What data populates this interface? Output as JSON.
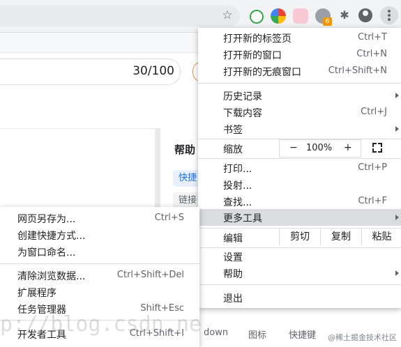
{
  "toolbar": {
    "star_icon": "bookmark-star-icon",
    "extension_badge": "6"
  },
  "page": {
    "counter": "30/100",
    "help_title": "帮助",
    "chip1": "快捷",
    "chip2": "链接"
  },
  "menu": {
    "new_tab": {
      "label": "打开新的标签页",
      "shortcut": "Ctrl+T"
    },
    "new_window": {
      "label": "打开新的窗口",
      "shortcut": "Ctrl+N"
    },
    "new_incognito": {
      "label": "打开新的无痕窗口",
      "shortcut": "Ctrl+Shift+N"
    },
    "history": {
      "label": "历史记录"
    },
    "downloads": {
      "label": "下载内容",
      "shortcut": "Ctrl+J"
    },
    "bookmarks": {
      "label": "书签"
    },
    "zoom": {
      "label": "缩放",
      "minus": "−",
      "value": "100%",
      "plus": "+"
    },
    "print": {
      "label": "打印...",
      "shortcut": "Ctrl+P"
    },
    "cast": {
      "label": "投射..."
    },
    "find": {
      "label": "查找...",
      "shortcut": "Ctrl+F"
    },
    "more_tools": {
      "label": "更多工具"
    },
    "edit": {
      "label": "编辑",
      "cut": "剪切",
      "copy": "复制",
      "paste": "粘贴"
    },
    "settings": {
      "label": "设置"
    },
    "help": {
      "label": "帮助"
    },
    "exit": {
      "label": "退出"
    }
  },
  "submenu": {
    "save_page": {
      "label": "网页另存为...",
      "shortcut": "Ctrl+S"
    },
    "create_shortcut": {
      "label": "创建快捷方式..."
    },
    "name_window": {
      "label": "为窗口命名..."
    },
    "clear_data": {
      "label": "清除浏览数据...",
      "shortcut": "Ctrl+Shift+Del"
    },
    "extensions": {
      "label": "扩展程序"
    },
    "task_manager": {
      "label": "任务管理器",
      "shortcut": "Shift+Esc"
    },
    "dev_tools": {
      "label": "开发者工具",
      "shortcut": "Ctrl+Shift+I"
    }
  },
  "bottom": {
    "frag1": "down",
    "frag2": "图标",
    "frag3": "快捷键",
    "watermark": "p://blog.csdn.ne",
    "credit": "@稀土掘金技术社区"
  }
}
